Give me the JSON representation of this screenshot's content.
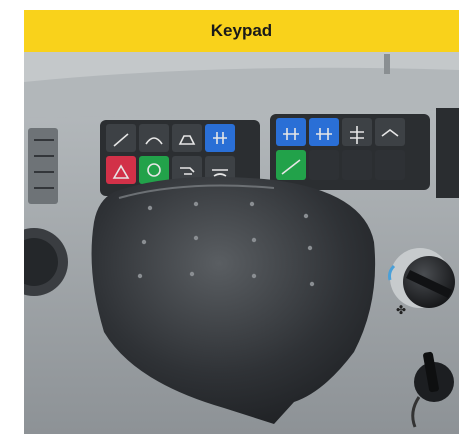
{
  "header": {
    "title": "Keypad"
  },
  "colors": {
    "title_bar": "#f9d21b",
    "blue_key": "#2a6fd6",
    "green_key": "#22a24a",
    "red_key": "#d23148"
  },
  "keypad_left": {
    "top_row_icons": [
      "wiper-rear-icon",
      "wiper-front-icon",
      "work-light-icon",
      "differential-lock-icon"
    ],
    "bottom_row_icons": [
      "hazard-icon",
      "beacon-icon",
      "light-icon",
      "defrost-icon"
    ]
  },
  "keypad_right": {
    "top_row_icons": [
      "mode-a-icon",
      "mode-b-icon",
      "fan-icon",
      "switch-icon"
    ],
    "bottom_row_icons": [
      "climb-icon",
      "blank-key",
      "blank-key",
      "blank-key"
    ]
  }
}
